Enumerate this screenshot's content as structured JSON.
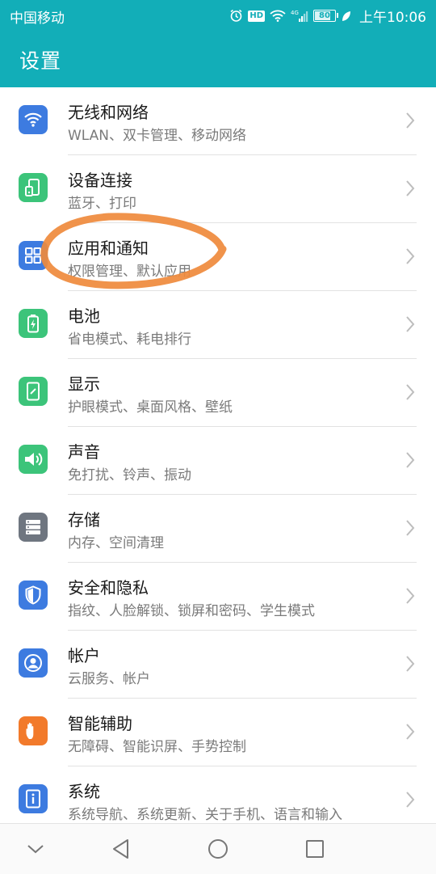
{
  "status_bar": {
    "carrier": "中国移动",
    "network": "4G",
    "battery": "80",
    "battery_level": 0.8,
    "time": "上午10:06",
    "icons": [
      "alarm-icon",
      "hd-icon",
      "wifi-icon",
      "signal-icon",
      "battery-icon",
      "leaf-icon"
    ]
  },
  "header": {
    "title": "设置"
  },
  "theme": {
    "accent": "#12aeb8",
    "annotation": "#ef8a3c",
    "icon_blue": "#3d7be0",
    "icon_green": "#3cc47a",
    "icon_gray": "#6f7680",
    "icon_orange": "#f27a2b"
  },
  "settings": {
    "items": [
      {
        "title": "无线和网络",
        "subtitle": "WLAN、双卡管理、移动网络",
        "icon": "wifi-icon"
      },
      {
        "title": "设备连接",
        "subtitle": "蓝牙、打印",
        "icon": "device-connection-icon"
      },
      {
        "title": "应用和通知",
        "subtitle": "权限管理、默认应用",
        "icon": "apps-grid-icon"
      },
      {
        "title": "电池",
        "subtitle": "省电模式、耗电排行",
        "icon": "battery-icon"
      },
      {
        "title": "显示",
        "subtitle": "护眼模式、桌面风格、壁纸",
        "icon": "display-icon"
      },
      {
        "title": "声音",
        "subtitle": "免打扰、铃声、振动",
        "icon": "speaker-icon"
      },
      {
        "title": "存储",
        "subtitle": "内存、空间清理",
        "icon": "storage-icon"
      },
      {
        "title": "安全和隐私",
        "subtitle": "指纹、人脸解锁、锁屏和密码、学生模式",
        "icon": "shield-icon"
      },
      {
        "title": "帐户",
        "subtitle": "云服务、帐户",
        "icon": "account-icon"
      },
      {
        "title": "智能辅助",
        "subtitle": "无障碍、智能识屏、手势控制",
        "icon": "hand-icon"
      },
      {
        "title": "系统",
        "subtitle": "系统导航、系统更新、关于手机、语言和输入",
        "icon": "system-info-icon"
      }
    ]
  },
  "nav_bar": {
    "buttons": [
      "chevron-down-icon",
      "back-triangle-icon",
      "home-circle-icon",
      "recents-square-icon"
    ]
  }
}
